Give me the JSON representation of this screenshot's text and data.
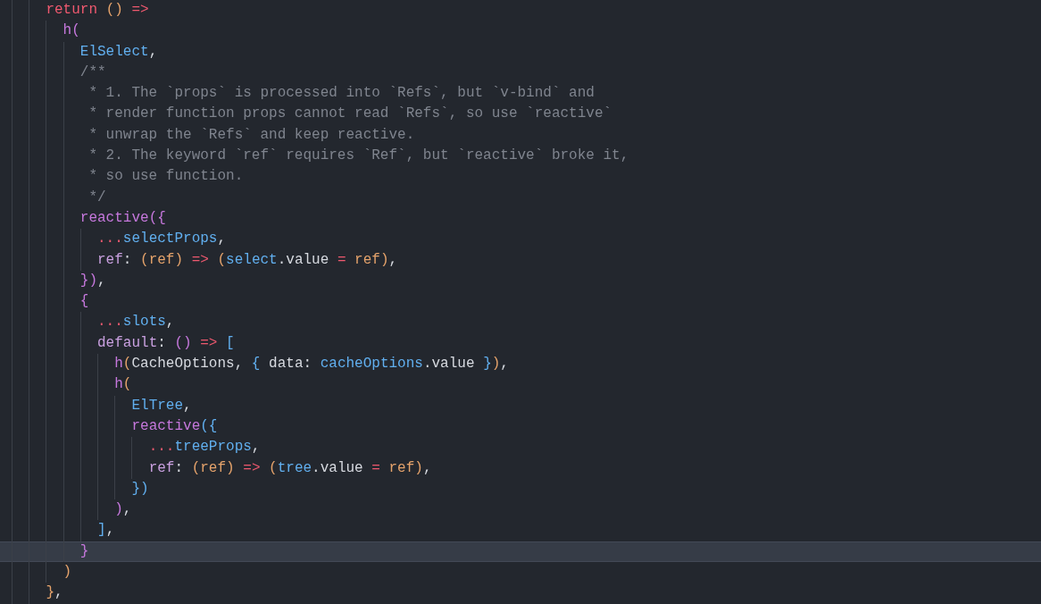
{
  "editor": {
    "lines": [
      {
        "current": false,
        "tokens": [
          {
            "text": "    return ",
            "kind": "keyword"
          },
          {
            "text": "()",
            "kind": "bracket-gold"
          },
          {
            "text": " =>",
            "kind": "operator"
          }
        ]
      },
      {
        "current": false,
        "tokens": [
          {
            "text": "      h",
            "kind": "function"
          },
          {
            "text": "(",
            "kind": "bracket-purple"
          }
        ]
      },
      {
        "current": false,
        "tokens": [
          {
            "text": "        ElSelect",
            "kind": "class"
          },
          {
            "text": ",",
            "kind": "plain"
          }
        ]
      },
      {
        "current": false,
        "tokens": [
          {
            "text": "        /**",
            "kind": "comment"
          }
        ]
      },
      {
        "current": false,
        "tokens": [
          {
            "text": "         * 1. The `props` is processed into `Refs`, but `v-bind` and",
            "kind": "comment"
          }
        ]
      },
      {
        "current": false,
        "tokens": [
          {
            "text": "         * render function props cannot read `Refs`, so use `reactive`",
            "kind": "comment"
          }
        ]
      },
      {
        "current": false,
        "tokens": [
          {
            "text": "         * unwrap the `Refs` and keep reactive.",
            "kind": "comment"
          }
        ]
      },
      {
        "current": false,
        "tokens": [
          {
            "text": "         * 2. The keyword `ref` requires `Ref`, but `reactive` broke it,",
            "kind": "comment"
          }
        ]
      },
      {
        "current": false,
        "tokens": [
          {
            "text": "         * so use function.",
            "kind": "comment"
          }
        ]
      },
      {
        "current": false,
        "tokens": [
          {
            "text": "         */",
            "kind": "comment"
          }
        ]
      },
      {
        "current": false,
        "tokens": [
          {
            "text": "        reactive",
            "kind": "function"
          },
          {
            "text": "({",
            "kind": "bracket-purple"
          }
        ]
      },
      {
        "current": false,
        "tokens": [
          {
            "text": "          ...",
            "kind": "operator"
          },
          {
            "text": "selectProps",
            "kind": "variable"
          },
          {
            "text": ",",
            "kind": "plain"
          }
        ]
      },
      {
        "current": false,
        "tokens": [
          {
            "text": "          ref",
            "kind": "property"
          },
          {
            "text": ": ",
            "kind": "plain"
          },
          {
            "text": "(",
            "kind": "bracket-gold"
          },
          {
            "text": "ref",
            "kind": "param"
          },
          {
            "text": ")",
            "kind": "bracket-gold"
          },
          {
            "text": " => ",
            "kind": "operator"
          },
          {
            "text": "(",
            "kind": "bracket-gold"
          },
          {
            "text": "select",
            "kind": "variable"
          },
          {
            "text": ".value ",
            "kind": "plain"
          },
          {
            "text": "= ",
            "kind": "operator"
          },
          {
            "text": "ref",
            "kind": "param"
          },
          {
            "text": ")",
            "kind": "bracket-gold"
          },
          {
            "text": ",",
            "kind": "plain"
          }
        ]
      },
      {
        "current": false,
        "tokens": [
          {
            "text": "        })",
            "kind": "bracket-purple"
          },
          {
            "text": ",",
            "kind": "plain"
          }
        ]
      },
      {
        "current": false,
        "tokens": [
          {
            "text": "        {",
            "kind": "bracket-purple"
          }
        ]
      },
      {
        "current": false,
        "tokens": [
          {
            "text": "          ...",
            "kind": "operator"
          },
          {
            "text": "slots",
            "kind": "variable"
          },
          {
            "text": ",",
            "kind": "plain"
          }
        ]
      },
      {
        "current": false,
        "tokens": [
          {
            "text": "          default",
            "kind": "property"
          },
          {
            "text": ": ",
            "kind": "plain"
          },
          {
            "text": "()",
            "kind": "bracket-purple"
          },
          {
            "text": " => ",
            "kind": "operator"
          },
          {
            "text": "[",
            "kind": "bracket-blue"
          }
        ]
      },
      {
        "current": false,
        "tokens": [
          {
            "text": "            h",
            "kind": "function"
          },
          {
            "text": "(",
            "kind": "bracket-gold"
          },
          {
            "text": "CacheOptions, ",
            "kind": "plain"
          },
          {
            "text": "{",
            "kind": "bracket-blue"
          },
          {
            "text": " data: ",
            "kind": "plain"
          },
          {
            "text": "cacheOptions",
            "kind": "variable"
          },
          {
            "text": ".value ",
            "kind": "plain"
          },
          {
            "text": "}",
            "kind": "bracket-blue"
          },
          {
            "text": ")",
            "kind": "bracket-gold"
          },
          {
            "text": ",",
            "kind": "plain"
          }
        ]
      },
      {
        "current": false,
        "tokens": [
          {
            "text": "            h",
            "kind": "function"
          },
          {
            "text": "(",
            "kind": "bracket-gold"
          }
        ]
      },
      {
        "current": false,
        "tokens": [
          {
            "text": "              ElTree",
            "kind": "class"
          },
          {
            "text": ",",
            "kind": "plain"
          }
        ]
      },
      {
        "current": false,
        "tokens": [
          {
            "text": "              reactive",
            "kind": "function"
          },
          {
            "text": "({",
            "kind": "bracket-blue"
          }
        ]
      },
      {
        "current": false,
        "tokens": [
          {
            "text": "                ...",
            "kind": "operator"
          },
          {
            "text": "treeProps",
            "kind": "variable"
          },
          {
            "text": ",",
            "kind": "plain"
          }
        ]
      },
      {
        "current": false,
        "tokens": [
          {
            "text": "                ref",
            "kind": "property"
          },
          {
            "text": ": ",
            "kind": "plain"
          },
          {
            "text": "(",
            "kind": "bracket-gold"
          },
          {
            "text": "ref",
            "kind": "param"
          },
          {
            "text": ")",
            "kind": "bracket-gold"
          },
          {
            "text": " => ",
            "kind": "operator"
          },
          {
            "text": "(",
            "kind": "bracket-gold"
          },
          {
            "text": "tree",
            "kind": "variable"
          },
          {
            "text": ".value ",
            "kind": "plain"
          },
          {
            "text": "= ",
            "kind": "operator"
          },
          {
            "text": "ref",
            "kind": "param"
          },
          {
            "text": ")",
            "kind": "bracket-gold"
          },
          {
            "text": ",",
            "kind": "plain"
          }
        ]
      },
      {
        "current": false,
        "tokens": [
          {
            "text": "              })",
            "kind": "bracket-blue"
          }
        ]
      },
      {
        "current": false,
        "tokens": [
          {
            "text": "            )",
            "kind": "bracket-purple"
          },
          {
            "text": ",",
            "kind": "plain"
          }
        ]
      },
      {
        "current": false,
        "tokens": [
          {
            "text": "          ]",
            "kind": "bracket-blue"
          },
          {
            "text": ",",
            "kind": "plain"
          }
        ]
      },
      {
        "current": true,
        "tokens": [
          {
            "text": "        }",
            "kind": "bracket-purple"
          }
        ]
      },
      {
        "current": false,
        "tokens": [
          {
            "text": "      )",
            "kind": "bracket-gold"
          }
        ]
      },
      {
        "current": false,
        "tokens": [
          {
            "text": "    }",
            "kind": "bracket-gold"
          },
          {
            "text": ",",
            "kind": "plain"
          }
        ]
      }
    ]
  }
}
